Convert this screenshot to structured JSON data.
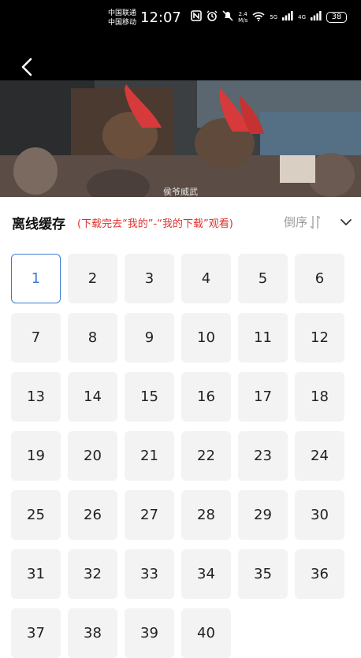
{
  "status_bar": {
    "carrier1": "中国联通",
    "carrier2": "中国移动",
    "time": "12:07",
    "net_speed_value": "2.4",
    "net_speed_unit": "M/s",
    "sig1": "5G",
    "sig2": "4G",
    "battery": "38"
  },
  "video": {
    "subtitle": "侯爷威武"
  },
  "header": {
    "title": "离线缓存",
    "hint": "(下载完去“我的”-“我的下载”观看)",
    "sort_label": "倒序"
  },
  "episodes": {
    "selected": "1",
    "items": [
      "1",
      "2",
      "3",
      "4",
      "5",
      "6",
      "7",
      "8",
      "9",
      "10",
      "11",
      "12",
      "13",
      "14",
      "15",
      "16",
      "17",
      "18",
      "19",
      "20",
      "21",
      "22",
      "23",
      "24",
      "25",
      "26",
      "27",
      "28",
      "29",
      "30",
      "31",
      "32",
      "33",
      "34",
      "35",
      "36",
      "37",
      "38",
      "39",
      "40"
    ]
  },
  "colors": {
    "accent": "#3a7bd5",
    "hint": "#e0302b",
    "tile_bg": "#f3f3f3"
  }
}
